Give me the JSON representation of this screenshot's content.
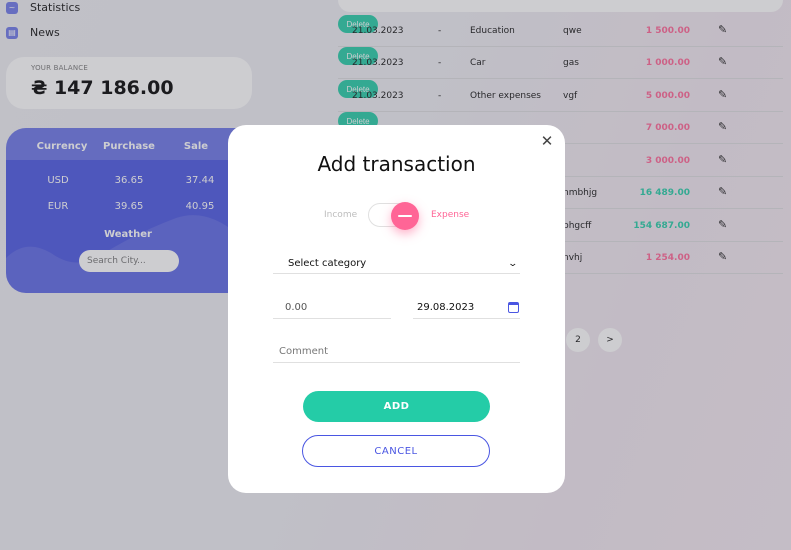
{
  "nav": [
    {
      "label": "Statistics",
      "icon": "chart-icon"
    },
    {
      "label": "News",
      "icon": "news-icon"
    }
  ],
  "balance": {
    "label": "YOUR BALANCE",
    "value": "₴ 147 186.00"
  },
  "currency": {
    "headers": [
      "Currency",
      "Purchase",
      "Sale"
    ],
    "rows": [
      {
        "currency": "USD",
        "purchase": "36.65",
        "sale": "37.44"
      },
      {
        "currency": "EUR",
        "purchase": "39.65",
        "sale": "40.95"
      }
    ],
    "weather_title": "Weather",
    "weather_placeholder": "Search City..."
  },
  "transactions": [
    {
      "date": "21.03.2023",
      "type": "-",
      "category": "Education",
      "comment": "qwe",
      "sum": "1 500.00",
      "kind": "neg"
    },
    {
      "date": "21.03.2023",
      "type": "-",
      "category": "Car",
      "comment": "gas",
      "sum": "1 000.00",
      "kind": "neg"
    },
    {
      "date": "21.03.2023",
      "type": "-",
      "category": "Other expenses",
      "comment": "vgf",
      "sum": "5 000.00",
      "kind": "neg"
    },
    {
      "date": "",
      "type": "",
      "category": "",
      "comment": "",
      "sum": "7 000.00",
      "kind": "neg"
    },
    {
      "date": "",
      "type": "",
      "category": "",
      "comment": "",
      "sum": "3 000.00",
      "kind": "neg"
    },
    {
      "date": "",
      "type": "",
      "category": "",
      "comment": "nmbhjg",
      "sum": "16 489.00",
      "kind": "pos"
    },
    {
      "date": "",
      "type": "",
      "category": "",
      "comment": "bhgcff",
      "sum": "154 687.00",
      "kind": "pos"
    },
    {
      "date": "",
      "type": "",
      "category": "",
      "comment": "nvhj",
      "sum": "1 254.00",
      "kind": "neg"
    }
  ],
  "delete_label": "Delete",
  "pagination": {
    "page": "2",
    "next": ">"
  },
  "modal": {
    "title": "Add transaction",
    "toggle_income": "Income",
    "toggle_expense": "Expense",
    "category_placeholder": "Select category",
    "amount_placeholder": "0.00",
    "date_value": "29.08.2023",
    "comment_placeholder": "Comment",
    "add_label": "ADD",
    "cancel_label": "CANCEL"
  },
  "colors": {
    "accent": "#24cca7",
    "expense": "#ff6596",
    "primary": "#4a56e2"
  }
}
